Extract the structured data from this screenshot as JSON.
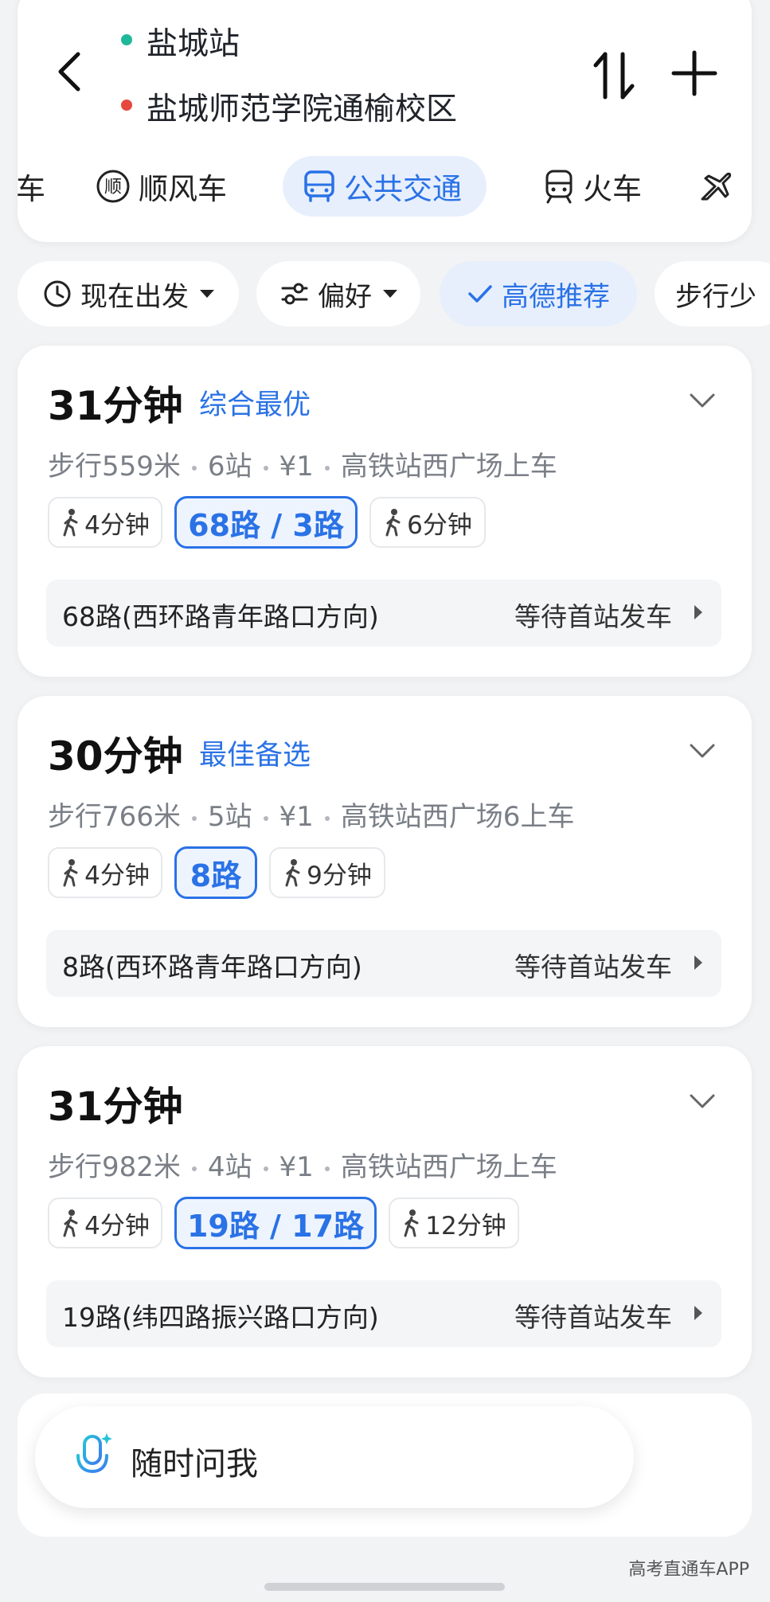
{
  "header": {
    "origin": "盐城站",
    "destination": "盐城师范学院通榆校区",
    "origin_color": "#1fb89a",
    "destination_color": "#e5483f"
  },
  "modes": [
    {
      "label": "车",
      "icon": "car-icon"
    },
    {
      "label": "顺风车",
      "icon": "carpool-icon"
    },
    {
      "label": "公共交通",
      "icon": "bus-icon",
      "active": true
    },
    {
      "label": "火车",
      "icon": "train-icon"
    },
    {
      "label": "",
      "icon": "plane-icon"
    }
  ],
  "filters": {
    "depart": "现在出发",
    "preference": "偏好",
    "recommend": "高德推荐",
    "less_walk": "步行少"
  },
  "routes": [
    {
      "duration": "31分钟",
      "tag": "综合最优",
      "walk": "步行559米",
      "stops": "6站",
      "fare": "¥1",
      "board": "高铁站西广场上车",
      "walk_start": "4分钟",
      "lines": "68路 / 3路",
      "walk_end": "6分钟",
      "line_name": "68路(西环路青年路口方向)",
      "status": "等待首站发车"
    },
    {
      "duration": "30分钟",
      "tag": "最佳备选",
      "walk": "步行766米",
      "stops": "5站",
      "fare": "¥1",
      "board": "高铁站西广场6上车",
      "walk_start": "4分钟",
      "lines": "8路",
      "walk_end": "9分钟",
      "line_name": "8路(西环路青年路口方向)",
      "status": "等待首站发车"
    },
    {
      "duration": "31分钟",
      "tag": "",
      "walk": "步行982米",
      "stops": "4站",
      "fare": "¥1",
      "board": "高铁站西广场上车",
      "walk_start": "4分钟",
      "lines": "19路 / 17路",
      "walk_end": "12分钟",
      "line_name": "19路(纬四路振兴路口方向)",
      "status": "等待首站发车"
    }
  ],
  "assistant": {
    "label": "随时问我"
  },
  "watermark": "高考直通车APP",
  "colors": {
    "accent": "#2a72e6",
    "active_bg": "#e7effd",
    "background": "#f2f3f5"
  }
}
